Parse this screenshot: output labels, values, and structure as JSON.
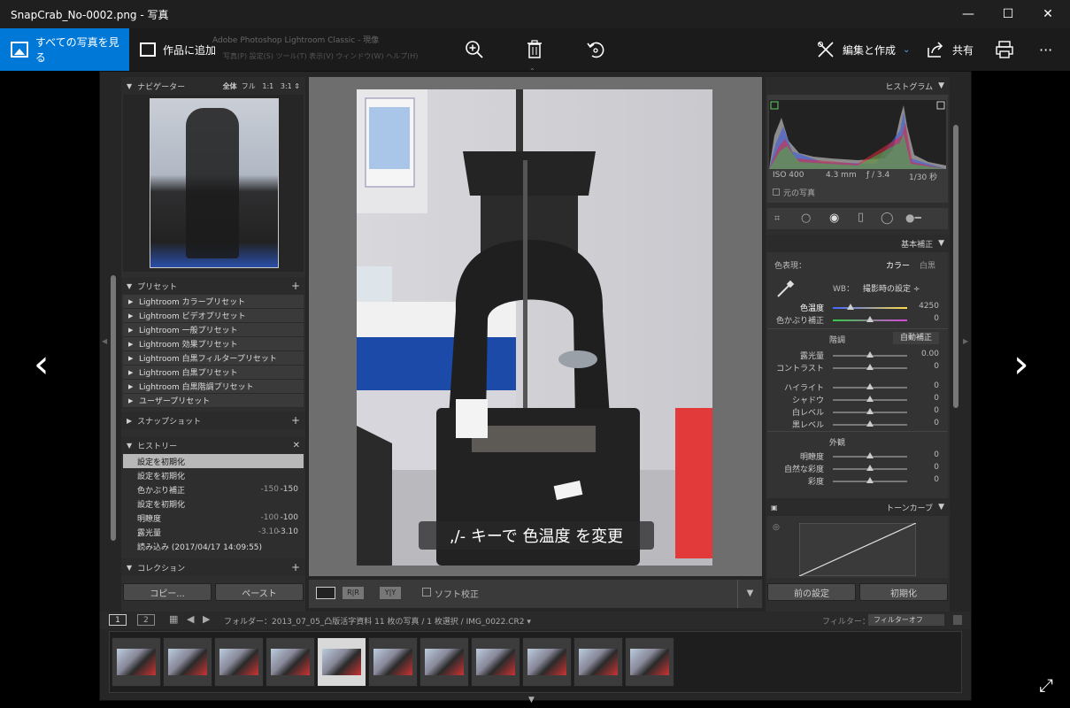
{
  "window": {
    "title": "SnapCrab_No-0002.png - 写真",
    "minimize": "—",
    "maximize": "☐",
    "close": "✕"
  },
  "appbar": {
    "all_photos": "すべての写真を見る",
    "add_to_creation": "作品に追加",
    "edit_create": "編集と作成",
    "share": "共有",
    "more": "···",
    "lr_window_title": "Adobe Photoshop Lightroom Classic - 現像",
    "lr_menu": "写真(P)  設定(S)  ツール(T)  表示(V)  ウィンドウ(W)  ヘルプ(H)"
  },
  "colors": {
    "accent": "#0078d7",
    "lr_panel": "#333333",
    "lr_bg": "#262626",
    "selected_history": "#b8b8b8"
  },
  "left_panel": {
    "navigator": {
      "title": "ナビゲーター",
      "zoom": [
        "全体",
        "フル",
        "1:1",
        "3:1"
      ]
    },
    "presets": {
      "title": "プリセット",
      "items": [
        "Lightroom カラープリセット",
        "Lightroom ビデオプリセット",
        "Lightroom 一般プリセット",
        "Lightroom 効果プリセット",
        "Lightroom 白黒フィルタープリセット",
        "Lightroom 白黒プリセット",
        "Lightroom 白黒階調プリセット",
        "ユーザープリセット"
      ]
    },
    "snapshots": {
      "title": "スナップショット"
    },
    "history": {
      "title": "ヒストリー",
      "items": [
        {
          "label": "設定を初期化",
          "v1": "",
          "v2": ""
        },
        {
          "label": "設定を初期化",
          "v1": "",
          "v2": ""
        },
        {
          "label": "色かぶり補正",
          "v1": "-150",
          "v2": "-150"
        },
        {
          "label": "設定を初期化",
          "v1": "",
          "v2": ""
        },
        {
          "label": "明瞭度",
          "v1": "-100",
          "v2": "-100"
        },
        {
          "label": "露光量",
          "v1": "-3.10",
          "v2": "-3.10"
        },
        {
          "label": "読み込み (2017/04/17 14:09:55)",
          "v1": "",
          "v2": ""
        }
      ]
    },
    "collections": {
      "title": "コレクション"
    },
    "copy_btn": "コピー...",
    "paste_btn": "ペースト"
  },
  "center": {
    "overlay_text": ",/- キーで 色温度 を変更",
    "soft_proof": "ソフト校正",
    "view_rr": "R|R",
    "view_yy": "Y|Y"
  },
  "right_panel": {
    "histogram": {
      "title": "ヒストグラム",
      "iso": "ISO 400",
      "focal": "4.3 mm",
      "aperture": "ƒ / 3.4",
      "shutter": "1/30 秒",
      "original": "元の写真"
    },
    "basic": {
      "title": "基本補正",
      "treatment_label": "色表現：",
      "color": "カラー",
      "bw": "白黒",
      "wb_label": "WB：",
      "wb_value": "撮影時の設定 ÷",
      "temp_label": "色温度",
      "temp_value": "4250",
      "tint_label": "色かぶり補正",
      "tint_value": "0",
      "tone_label": "階調",
      "auto": "自動補正",
      "tone_sliders": [
        {
          "label": "露光量",
          "value": "0.00"
        },
        {
          "label": "コントラスト",
          "value": "0"
        }
      ],
      "range_sliders": [
        {
          "label": "ハイライト",
          "value": "0"
        },
        {
          "label": "シャドウ",
          "value": "0"
        },
        {
          "label": "白レベル",
          "value": "0"
        },
        {
          "label": "黒レベル",
          "value": "0"
        }
      ],
      "presence_label": "外観",
      "presence_sliders": [
        {
          "label": "明瞭度",
          "value": "0"
        },
        {
          "label": "自然な彩度",
          "value": "0"
        },
        {
          "label": "彩度",
          "value": "0"
        }
      ]
    },
    "tone_curve": {
      "title": "トーンカーブ"
    },
    "prev_btn": "前の設定",
    "reset_btn": "初期化"
  },
  "filmstrip": {
    "page1": "1",
    "page2": "2",
    "folder_info": "フォルダー：2013_07_05_凸版活字資料   11 枚の写真 / 1 枚選択 / IMG_0022.CR2 ▾",
    "filter_label": "フィルター：",
    "filter_value": "フィルターオフ",
    "thumb_count": 11,
    "selected_index": 4
  }
}
